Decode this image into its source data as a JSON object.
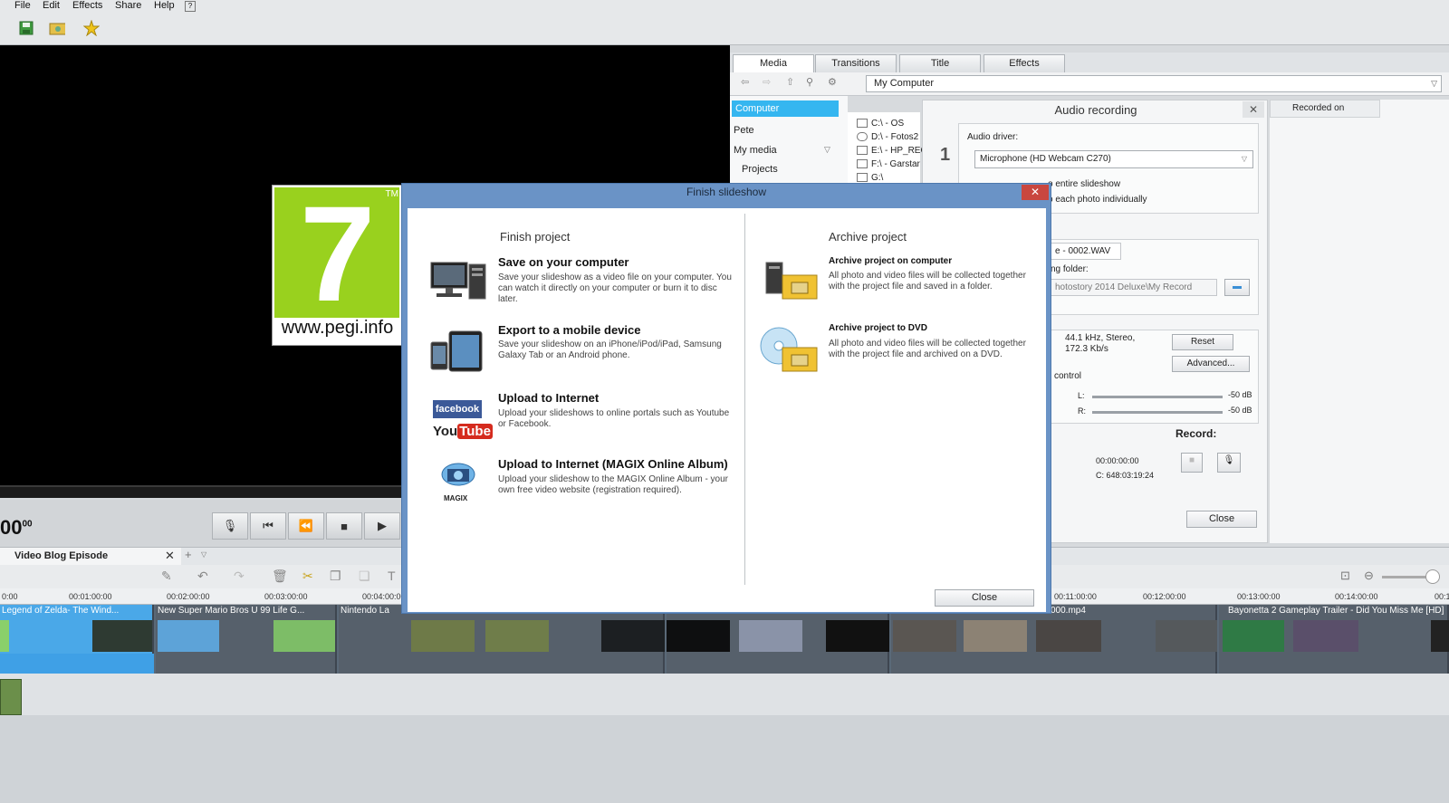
{
  "menu": [
    "File",
    "Edit",
    "Effects",
    "Share",
    "Help"
  ],
  "preview": {
    "pegi_rating": "7",
    "pegi_tm": "TM",
    "pegi_url": "www.pegi.info",
    "timecode": "00",
    "timecode_frames": "00"
  },
  "media_tabs": [
    "Media",
    "Transitions",
    "Title",
    "Effects"
  ],
  "location": "My Computer",
  "nav": {
    "items": [
      "Computer",
      "Pete",
      "My media",
      "Projects"
    ]
  },
  "drives": [
    "C:\\ - OS",
    "D:\\ - Fotos2",
    "E:\\ - HP_REC",
    "F:\\ - Garstar",
    "G:\\"
  ],
  "audio_recording": {
    "title": "Audio recording",
    "close_x": "✕",
    "step_number": "1",
    "driver_label": "Audio driver:",
    "driver_value": "Microphone (HD Webcam C270)",
    "option_entire": "o entire slideshow",
    "option_each": "o each photo individually",
    "file_name": "e - 0002.WAV",
    "folder_label": "ng folder:",
    "folder_path": "hotostory 2014 Deluxe\\My Record",
    "quality": "44.1 kHz, Stereo,",
    "bitrate": "172.3 Kb/s",
    "reset": "Reset",
    "advanced": "Advanced...",
    "control_label": "control",
    "left_label": "L:",
    "right_label": "R:",
    "left_db": "-50 dB",
    "right_db": "-50 dB",
    "record_label": "Record:",
    "record_time": "00:00:00:00",
    "record_capacity": "C: 648:03:19:24",
    "close": "Close"
  },
  "recorded_on": "Recorded on",
  "timeline": {
    "tab_name": "Video Blog Episode",
    "ruler": [
      "0:00",
      "00:01:00:00",
      "00:02:00:00",
      "00:03:00:00",
      "00:04:00:00",
      "00:11:00:00",
      "00:12:00:00",
      "00:13:00:00",
      "00:14:00:00",
      "00:1"
    ],
    "clips": [
      "Legend of Zelda- The Wind...",
      "New Super Mario Bros U 99 Life G...",
      "Nintendo La",
      "000.mp4",
      "Bayonetta 2 Gameplay Trailer - Did You Miss Me [HD]"
    ]
  },
  "dialog": {
    "title": "Finish slideshow",
    "close_x": "✕",
    "finish_heading": "Finish project",
    "archive_heading": "Archive project",
    "finish_options": [
      {
        "title": "Save on your computer",
        "desc": "Save your slideshow as a video file on your computer. You can watch it directly on your computer or burn it to disc later."
      },
      {
        "title": "Export to a mobile device",
        "desc": "Save your slideshow on an iPhone/iPod/iPad, Samsung Galaxy Tab or an Android phone."
      },
      {
        "title": "Upload to Internet",
        "desc": "Upload your slideshows to online portals such as Youtube or Facebook."
      },
      {
        "title": "Upload to Internet (MAGIX Online Album)",
        "desc": "Upload your slideshow to the MAGIX Online Album - your own free video website (registration required)."
      }
    ],
    "archive_options": [
      {
        "title": "Archive project on computer",
        "desc": "All photo and video files will be collected together with the project file and saved in a folder."
      },
      {
        "title": "Archive project to DVD",
        "desc": "All photo and video files will be collected together with the project file and archived on a DVD."
      }
    ],
    "facebook_logo": "facebook",
    "youtube_logo_you": "You",
    "youtube_logo_tube": "Tube",
    "magix_logo": "MAGIX",
    "close_button": "Close"
  },
  "colors": {
    "accent": "#35b6f0",
    "dialog_frame": "#6a93c6",
    "pegi_green": "#99d11e",
    "close_red": "#c9473f"
  }
}
